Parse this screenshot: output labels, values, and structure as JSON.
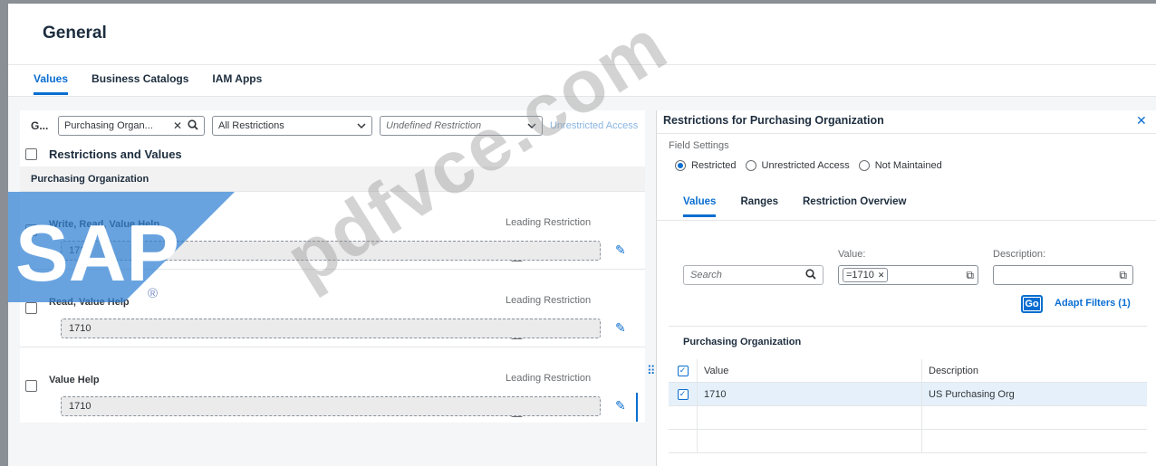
{
  "page": {
    "title": "General",
    "tabs": [
      {
        "label": "Values",
        "active": true
      },
      {
        "label": "Business Catalogs",
        "active": false
      },
      {
        "label": "IAM Apps",
        "active": false
      }
    ]
  },
  "left_panel": {
    "group_label": "G...",
    "field_combo": {
      "value": "Purchasing Organ..."
    },
    "restriction_select": {
      "value": "All Restrictions"
    },
    "restriction_type_select": {
      "placeholder": "Undefined Restriction"
    },
    "unrestricted_button": "Unrestricted Access",
    "section_title": "Restrictions and Values",
    "group_header": "Purchasing Organization",
    "restrictions": [
      {
        "label": "Write, Read, Value Help",
        "leading": "Leading Restriction",
        "value": "1710"
      },
      {
        "label": "Read, Value Help",
        "leading": "Leading Restriction",
        "value": "1710"
      },
      {
        "label": "Value Help",
        "leading": "Leading Restriction",
        "value": "1710"
      }
    ]
  },
  "right_panel": {
    "title": "Restrictions for Purchasing Organization",
    "field_settings_label": "Field Settings",
    "radio_options": [
      {
        "label": "Restricted",
        "selected": true
      },
      {
        "label": "Unrestricted Access",
        "selected": false
      },
      {
        "label": "Not Maintained",
        "selected": false
      }
    ],
    "tabs": [
      {
        "label": "Values",
        "active": true
      },
      {
        "label": "Ranges",
        "active": false
      },
      {
        "label": "Restriction Overview",
        "active": false
      }
    ],
    "filter": {
      "search_placeholder": "Search",
      "value_label": "Value:",
      "value_token": "=1710",
      "description_label": "Description:",
      "go_label": "Go",
      "adapt_filters": "Adapt Filters (1)"
    },
    "table": {
      "title": "Purchasing Organization",
      "columns": [
        "Value",
        "Description"
      ],
      "rows": [
        {
          "value": "1710",
          "description": "US Purchasing Org",
          "selected": true
        }
      ]
    }
  },
  "watermark": {
    "text": "pdfvce.com",
    "logo_text": "SAP",
    "logo_color": "#2f7fd3"
  },
  "colors": {
    "accent": "#0a6ed1",
    "title": "#1d2d3e"
  }
}
